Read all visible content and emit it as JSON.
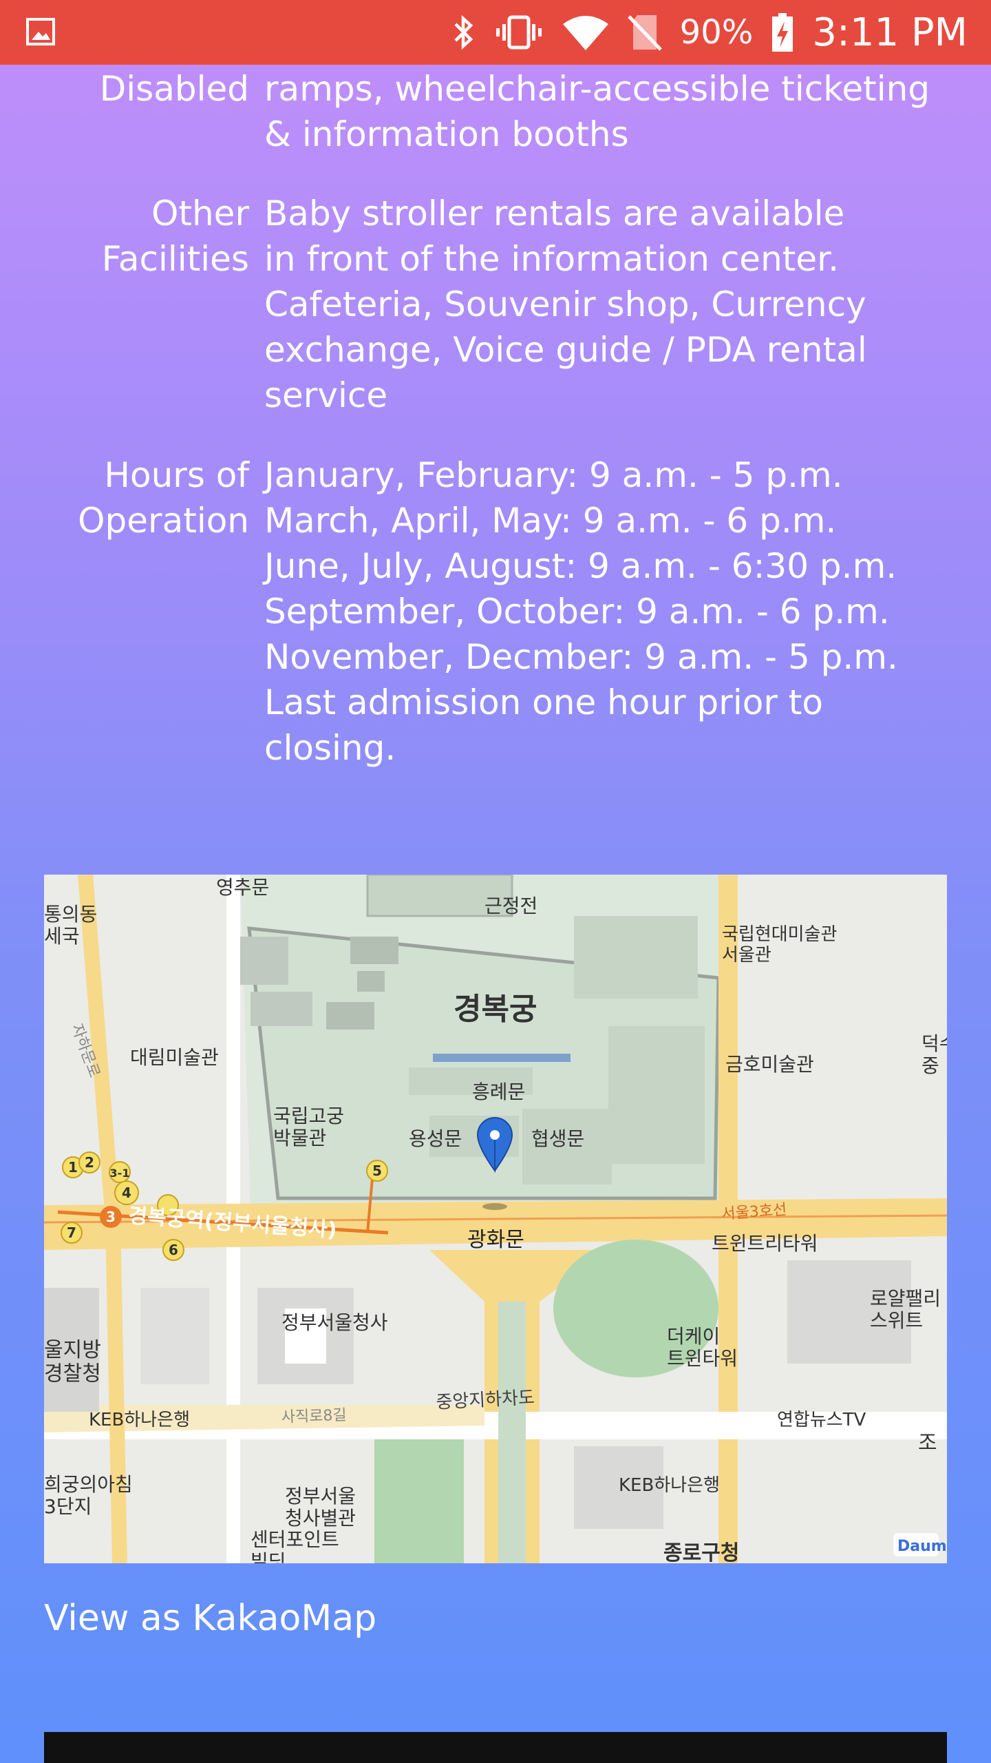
{
  "status_bar": {
    "battery": "90%",
    "time": "3:11 PM",
    "icons": [
      "image-icon",
      "bluetooth-icon",
      "vibrate-icon",
      "wifi-icon",
      "no-sim-icon",
      "battery-charging-icon"
    ]
  },
  "info": {
    "disabled": {
      "label": "Disabled",
      "value": "ramps, wheelchair-accessible ticketing\n& information booths"
    },
    "other": {
      "label": "Other\nFacilities",
      "value": "Baby stroller rentals are available\nin front of the information center.\nCafeteria, Souvenir shop, Currency\nexchange, Voice guide / PDA rental\nservice"
    },
    "hours": {
      "label": "Hours of\nOperation",
      "value": "January, February: 9 a.m. - 5 p.m.\nMarch, April, May: 9 a.m. - 6 p.m.\nJune, July, August: 9 a.m. - 6:30 p.m.\nSeptember, October: 9 a.m. - 6 p.m.\nNovember, Decmber: 9 a.m. - 5 p.m.\nLast admission one hour prior to\nclosing."
    }
  },
  "map": {
    "labels": {
      "yeongchumun": "영추문",
      "geunjeongjeon": "근정전",
      "gyeongbokgung": "경복궁",
      "heungnyemun": "흥례문",
      "yongseongmun": "용성문",
      "hyeopsaengmun": "협생문",
      "gwanghwamun": "광화문",
      "national_palace_museum": "국립고궁\n박물관",
      "daelim_museum": "대림미술관",
      "mmca": "국립현대미술관\n서울관",
      "kumho_museum": "금호미술관",
      "station": "경복궁역(정부서울청사)",
      "line3": "서울3호선",
      "twin_tree": "트윈트리타워",
      "gov_complex": "정부서울청사",
      "k_twin": "더케이\n트윈타워",
      "jungang_road": "중앙지하차도",
      "sajik_road": "사직로8길",
      "keb1": "KEB하나은행",
      "keb2": "KEB하나은행",
      "yonhap": "연합뉴스TV",
      "royal_palace": "로얄팰리\n스위트",
      "gov_annex": "정부서울\n청사별관",
      "center_point": "센터포인트\n빌딩",
      "hwigung": "희궁의아침\n3단지",
      "police": "울지방\n경찰청",
      "tongui": "통의동\n세국",
      "jahamunro": "자하문로",
      "deoksu": "덕수\n중",
      "jongno": "종로구청",
      "jo": "조",
      "daum": "Daum",
      "exits": [
        "1",
        "2",
        "3",
        "3-1",
        "4",
        "5",
        "6",
        "7"
      ]
    }
  },
  "map_link": "View as KakaoMap"
}
